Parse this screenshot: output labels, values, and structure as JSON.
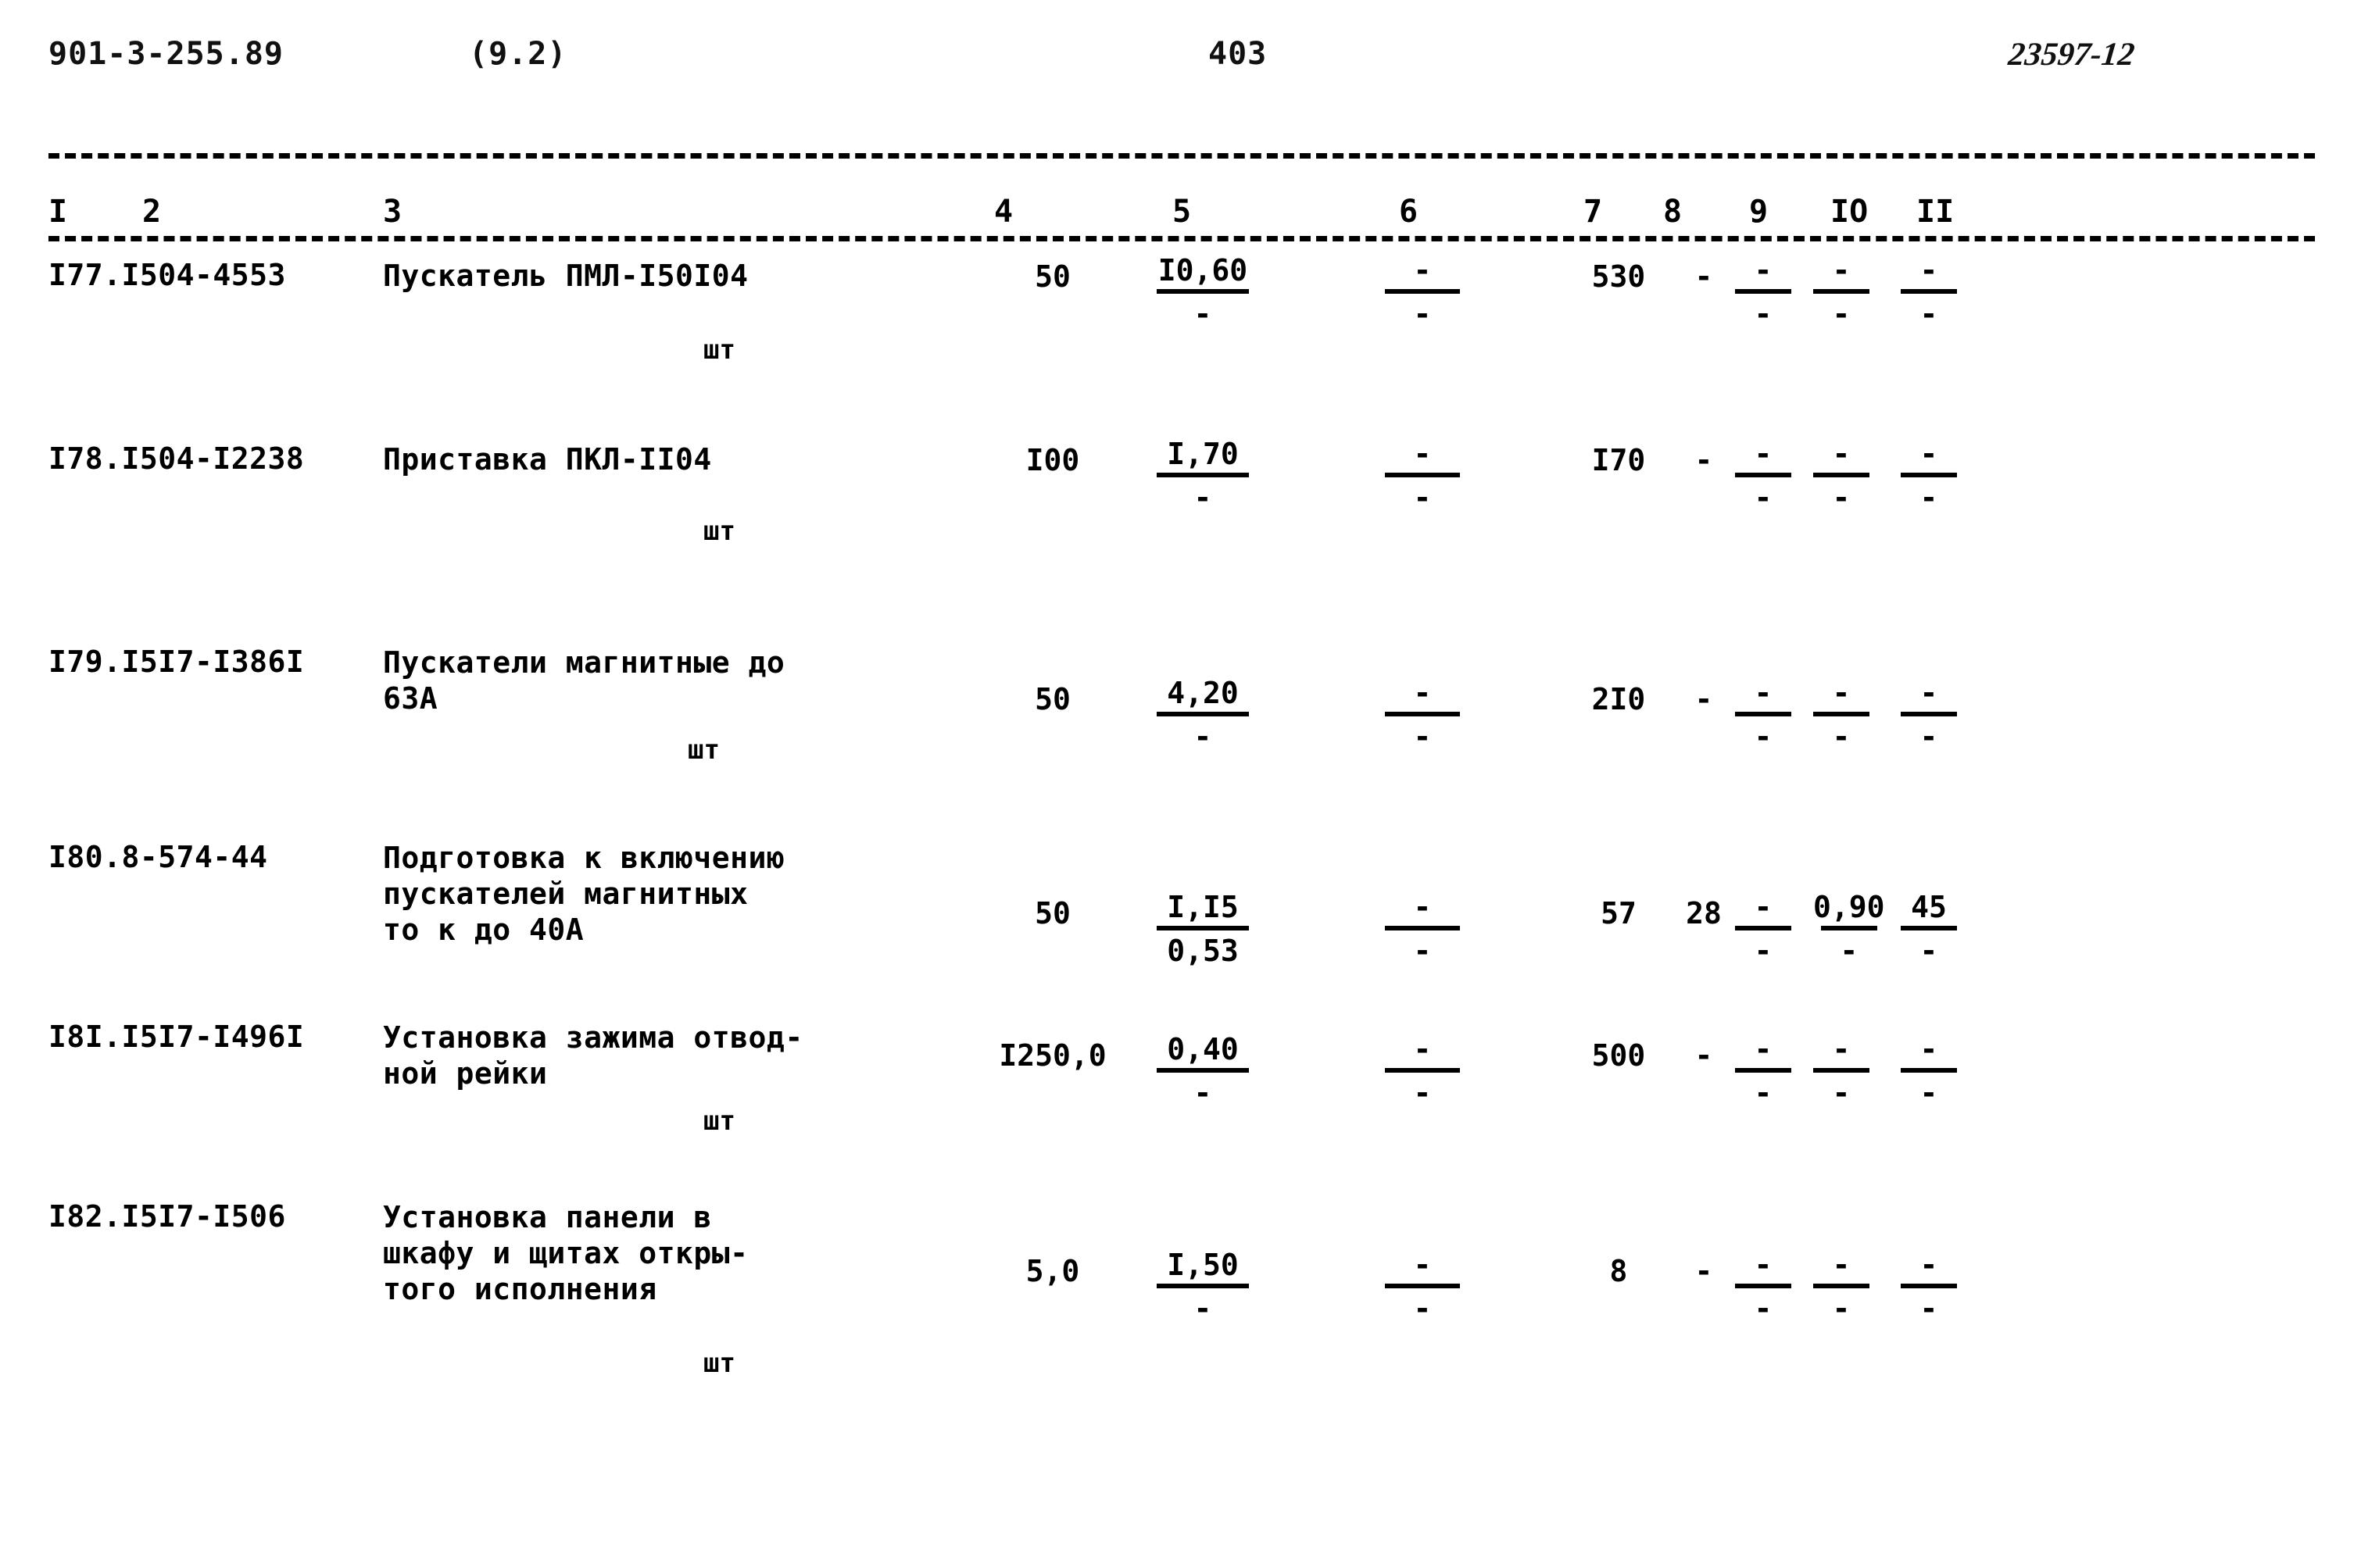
{
  "header": {
    "series_code": "901-3-255.89",
    "section": "(9.2)",
    "page_number": "403",
    "doc_number": "23597-12"
  },
  "table": {
    "column_headers": [
      "I",
      "2",
      "3",
      "4",
      "5",
      "6",
      "7",
      "8",
      "9",
      "IO",
      "II"
    ],
    "rows": [
      {
        "code": "I77.I504-4553",
        "name": "Пускатель ПМЛ-I50I04",
        "unit": "шт",
        "col4": "50",
        "col5_num": "I0,60",
        "col5_den": "-",
        "col6_num": "-",
        "col6_den": "-",
        "col7": "530",
        "col8": "-",
        "col9_num": "-",
        "col9_den": "-",
        "col10_num": "-",
        "col10_den": "-",
        "col11_num": "-",
        "col11_den": "-"
      },
      {
        "code": "I78.I504-I2238",
        "name": "Приставка ПКЛ-II04",
        "unit": "шт",
        "col4": "I00",
        "col5_num": "I,70",
        "col5_den": "-",
        "col6_num": "-",
        "col6_den": "-",
        "col7": "I70",
        "col8": "-",
        "col9_num": "-",
        "col9_den": "-",
        "col10_num": "-",
        "col10_den": "-",
        "col11_num": "-",
        "col11_den": "-"
      },
      {
        "code": "I79.I5I7-I386I",
        "name": "Пускатели магнитные до\n63А",
        "unit": "шт",
        "col4": "50",
        "col5_num": "4,20",
        "col5_den": "-",
        "col6_num": "-",
        "col6_den": "-",
        "col7": "2I0",
        "col8": "-",
        "col9_num": "-",
        "col9_den": "-",
        "col10_num": "-",
        "col10_den": "-",
        "col11_num": "-",
        "col11_den": "-"
      },
      {
        "code": "I80.8-574-44",
        "name": "Подготовка к включению\nпускателей магнитных\nто к до 40А",
        "unit": "",
        "col4": "50",
        "col5_num": "I,I5",
        "col5_den": "0,53",
        "col6_num": "-",
        "col6_den": "-",
        "col7": "57",
        "col8": "28",
        "col9_num": "-",
        "col9_den": "-",
        "col10_num": "0,90",
        "col10_den": "-",
        "col11_num": "45",
        "col11_den": "-"
      },
      {
        "code": "I8I.I5I7-I496I",
        "name": "Установка зажима отвод-\nной рейки",
        "unit": "шт",
        "col4": "I250,0",
        "col5_num": "0,40",
        "col5_den": "-",
        "col6_num": "-",
        "col6_den": "-",
        "col7": "500",
        "col8": "-",
        "col9_num": "-",
        "col9_den": "-",
        "col10_num": "-",
        "col10_den": "-",
        "col11_num": "-",
        "col11_den": "-"
      },
      {
        "code": "I82.I5I7-I506",
        "name": "Установка панели в\nшкафу   и щитах откры-\nтого исполнения",
        "unit": "шт",
        "col4": "5,0",
        "col5_num": "I,50",
        "col5_den": "-",
        "col6_num": "-",
        "col6_den": "-",
        "col7": "8",
        "col8": "-",
        "col9_num": "-",
        "col9_den": "-",
        "col10_num": "-",
        "col10_den": "-",
        "col11_num": "-",
        "col11_den": "-"
      }
    ]
  }
}
